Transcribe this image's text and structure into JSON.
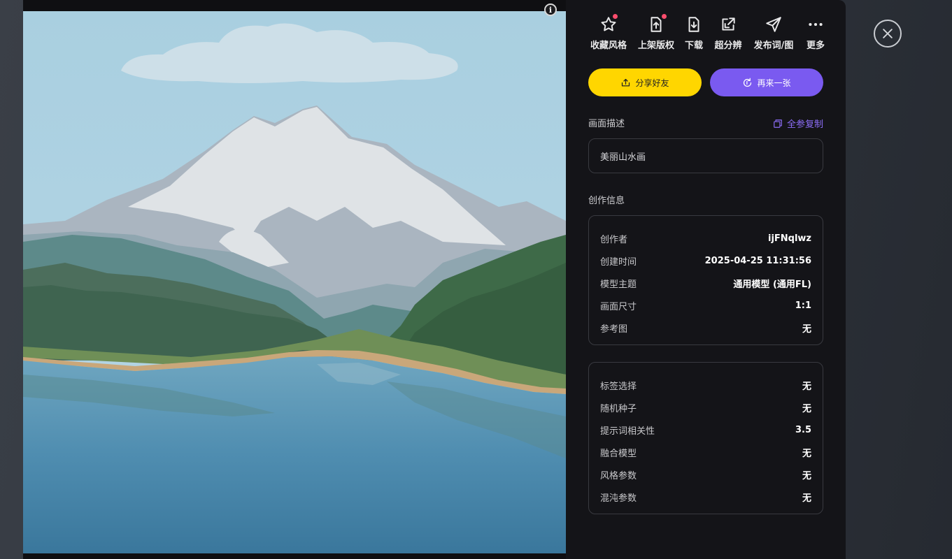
{
  "toolbar": {
    "items": [
      {
        "label": "收藏风格",
        "icon": "star-icon",
        "badge": true
      },
      {
        "label": "上架版权",
        "icon": "upload-file-icon",
        "badge": true
      },
      {
        "label": "下载",
        "icon": "download-file-icon",
        "badge": false
      },
      {
        "label": "超分辨",
        "icon": "upscale-icon",
        "badge": false
      },
      {
        "label": "发布词/图",
        "icon": "send-icon",
        "badge": false
      },
      {
        "label": "更多",
        "icon": "more-icon",
        "badge": false
      }
    ]
  },
  "actions": {
    "share_label": "分享好友",
    "again_label": "再来一张"
  },
  "description": {
    "title": "画面描述",
    "copy_label": "全参复制",
    "text": "美丽山水画"
  },
  "creation": {
    "title": "创作信息",
    "rows": [
      {
        "key": "创作者",
        "value": "ijFNqlwz"
      },
      {
        "key": "创建时间",
        "value": "2025-04-25 11:31:56"
      },
      {
        "key": "模型主题",
        "value": "通用模型 (通用FL)"
      },
      {
        "key": "画面尺寸",
        "value": "1:1"
      },
      {
        "key": "参考图",
        "value": "无"
      }
    ]
  },
  "params": {
    "rows": [
      {
        "key": "标签选择",
        "value": "无"
      },
      {
        "key": "随机种子",
        "value": "无"
      },
      {
        "key": "提示词相关性",
        "value": "3.5"
      },
      {
        "key": "融合模型",
        "value": "无"
      },
      {
        "key": "风格参数",
        "value": "无"
      },
      {
        "key": "混沌参数",
        "value": "无"
      }
    ]
  },
  "image": {
    "info_icon": "info-icon"
  },
  "colors": {
    "accent_yellow": "#ffd600",
    "accent_purple": "#7a5af0",
    "link_purple": "#8c6df7",
    "badge_red": "#ff4d6d"
  }
}
